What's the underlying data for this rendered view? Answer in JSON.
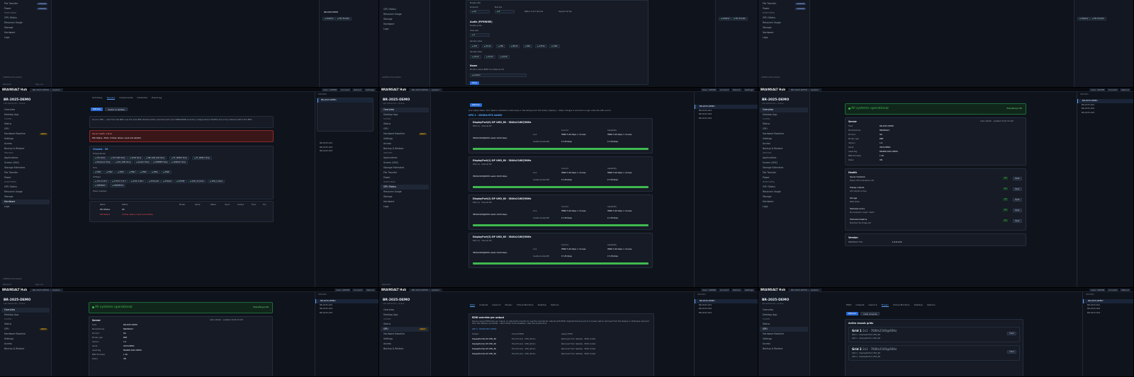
{
  "app": {
    "name": "BRAINSALT Hub",
    "host": "BR-2025-DEMO",
    "host_sub": "192.168.42.20 • Online",
    "footer": "ADMIN Administrator",
    "signout": "Sign out",
    "tab": "BR-2025-DEMO — System"
  },
  "toolbar": {
    "user": "User: ADMIN",
    "connect": "Connect",
    "reboot": "Reboot",
    "settings": "Settings"
  },
  "sidebar": {
    "top": [
      "Overview",
      "Desktop App"
    ],
    "section1": "SYSTEM",
    "items1": [
      "Status",
      "GPU",
      "Hardware Baseline",
      "Settings",
      "Access",
      "Backup & Restore"
    ],
    "section2": "SERVICES",
    "items2": [
      "Applications",
      "Screen (VNC)",
      "Storage Estimates",
      "File Transfer",
      "Power"
    ],
    "section3": "MONITORING",
    "items3": [
      "GPU Status",
      "Resource Usage",
      "Storage",
      "Hardware",
      "Logs"
    ],
    "badge_new": "UPGRADE",
    "badge_warn": "DRAFT"
  },
  "hostlist": {
    "title": "SERVERS",
    "items": [
      "BR-2025-DEMO",
      "BR-2025-001",
      "BR-2025-002",
      "BR-2025-003"
    ]
  },
  "status": {
    "tabs": [
      "Summary",
      "Sensors",
      "Components",
      "Controller",
      "Event log"
    ],
    "refresh": "Refresh",
    "switch": "Switch to Redfish",
    "source_note": "Source: IPMI — read from the BMC over the local IPMI interface (KCS), plus the host's own SMBIOS/MIB inventory. Independent of Redfish and of any network path to the BMC.",
    "critical_title": "Server health: critical",
    "critical_line": "PSU Status · PSU1: Critical, failure, input lost (AC/DC)",
    "chassis": "Chassis · 90",
    "temps_label": "Temperatures",
    "temps": [
      "CPU Temp",
      "CPU VRM Temp",
      "GPU0 Temp",
      "MB_VRM_SAN Temp",
      "PT_DIMM0 Temp",
      "PT_DIMM1 Temp",
      "Peripheral Temp",
      "SOC_VRM Temp",
      "System Temp",
      "VRMMEM Temp",
      "VRMSOC Temp"
    ],
    "fans_label": "Fans",
    "fans": [
      "FAN1",
      "FAN2",
      "FAN3",
      "FAN4",
      "FAN5",
      "FANA",
      "FANB"
    ],
    "volt_label": "Voltages",
    "volts": [
      "12V  12.05 V",
      "3.3VCC  3.31 V",
      "5VCC  4.98 V",
      "5VCCAUX",
      "5VDUAL",
      "5VSTBY",
      "VDD_33_DUAL",
      "VDD_5_DUAL",
      "VMEMSOC",
      "VMEMPSOC"
    ],
    "psu_label": "Power supplies",
    "psu_headers": [
      "Name",
      "Status",
      "Model",
      "Serial",
      "Rated",
      "Input",
      "Output",
      "Fans",
      "Fan"
    ],
    "psu_rows": [
      [
        "PS1 Status",
        "OK"
      ],
      [
        "PS2 Status",
        "Critical, failure, input lost (AC/DC)"
      ]
    ]
  },
  "gpu": {
    "refresh": "Refresh",
    "note": "Live output status. Port detail is refreshed continuously in the background; the history (display + rates) changes is recorded in Logs under the GPU source.",
    "gpu_title": "GPU 1 · NVIDIA RTX A4000",
    "ports": [
      {
        "name": "DisplayPort(0) DP UHD_60 · 3840x2160@60Hz",
        "sub": "DP(1.4) · internal DP"
      },
      {
        "name": "DisplayPort(1) DP UHD_60 · 3840x2160@60Hz",
        "sub": "DP(1.4) · internal DP"
      },
      {
        "name": "DisplayPort(2) DP UHD_60 · 3840x2160@60Hz",
        "sub": "DP(1.4) · internal DP"
      },
      {
        "name": "DisplayPort(3) DP UHD_60 · 3840x2160@60Hz",
        "sub": "DP(1.4) · internal DP"
      }
    ],
    "cols": [
      "Current",
      "Capability"
    ],
    "link_label": "Link",
    "link_cur": "HBR2 5.40 Gbps × 4 lanes",
    "link_cap": "HBR2 5.40 Gbps × 4 lanes",
    "bw_label": "Usable bandwidth",
    "bw_cur": "17.28 Gbps",
    "bw_cap": "17.28 Gbps",
    "needs": "3840x2160@60Hz needs 16.00 Gbps",
    "bw_fraction": 1.0
  },
  "overview": {
    "banner": "All systems operational",
    "banner_right": "Everything is OK",
    "server_title": "Server",
    "auto_refresh": "Auto-refresh · updated 12:01:52 AM",
    "server_kv": [
      [
        "Host",
        "BR-2025-DEMO"
      ],
      [
        "Manufacturer",
        "BRAINSALT"
      ],
      [
        "Product",
        "RG"
      ],
      [
        "Model / gen",
        "BRP"
      ],
      [
        "Version",
        "1.0"
      ],
      [
        "Serial",
        "2025-DEMO"
      ],
      [
        "Asset tag",
        "BR-BRP-2025-DEMO"
      ],
      [
        "BMC firmware",
        "1.36"
      ],
      [
        "Power",
        "ON"
      ]
    ],
    "health_title": "Health",
    "health": [
      [
        "Server hardware",
        "Power, PSU indications OK"
      ],
      [
        "Display outputs",
        "4/4 outputs active"
      ],
      [
        "Storage",
        "RAID state"
      ],
      [
        "Hardware errors",
        "No hardware 'repair' alerts"
      ],
      [
        "Hardware baseline",
        "Matches the image set"
      ]
    ],
    "ok": "OK",
    "open": "Open",
    "version_title": "Version",
    "version_k": "BRAINSALT Hub",
    "version_v": "1.0.0-1.19"
  },
  "edid": {
    "tabs": [
      "EDID",
      "Outputs",
      "Genlock",
      "Mosaic",
      "Virtual Monitors",
      "Desktop",
      "Options"
    ],
    "title": "EDID override per output",
    "desc": "Serve a saved EDID blob per output, so (about the monitor) to use the override for outputs with EDID. Outputs that are part of a mosaic will be removed from the display or otherwise removed from the desktop are hidden - return them to the desktop / clear the mosaic first.",
    "gpu": "GPU 1 · NVIDIA RTX A4000",
    "headers": [
      "Output",
      "Current EDID",
      "Assign EDID"
    ],
    "rows": [
      [
        "DisplayPort(0) DP UHD_60",
        "File (Forced) · UHD_60.bin",
        "Removed from desktop · EDID locked"
      ],
      [
        "DisplayPort(1) DP UHD_60",
        "File (Forced) · UHD_60.bin",
        "Removed from desktop · EDID locked"
      ],
      [
        "DisplayPort(2) DP UHD_60",
        "File (Forced) · UHD_60.bin",
        "Removed from desktop · EDID locked"
      ],
      [
        "DisplayPort(3) DP UHD_60",
        "File (Forced) · UHD_60.bin",
        "Removed from desktop · EDID locked"
      ]
    ]
  },
  "mosaic": {
    "tabs": [
      "EDID",
      "Outputs",
      "Genlock",
      "Mosaic",
      "Virtual Monitors",
      "Desktop",
      "Options"
    ],
    "refresh": "Refresh",
    "clear": "Clear all grids",
    "title": "Active mosaic grids",
    "grids": [
      {
        "name": "Grid 1",
        "spec": "2x1 · 7680x2160@60Hz",
        "l1": "GPU 1 · DisplayPort(0) UHD_60",
        "l2": "GPU 1 · DisplayPort(1) UHD_60"
      },
      {
        "name": "Grid 2",
        "spec": "2x1 · 7680x2160@60Hz",
        "l1": "GPU 1 · DisplayPort(2) UHD_60",
        "l2": "GPU 1 · DisplayPort(3) UHD_60"
      }
    ],
    "clear_btn": "Clear"
  },
  "audio": {
    "enable_osc": "Enable OSC",
    "endpoint": "Endpoint",
    "max_fps": "Max fps",
    "ep_val": "10",
    "fps_val": "8",
    "cb1": "Native 4:2:0 decode",
    "cb2": "Support all fps",
    "audio_title": "Audio (PIPEWIRE)",
    "enable_audio": "Enable audio",
    "channels": "Channels",
    "ch_val": "2",
    "sample_rates": "Sample rates",
    "rates": [
      "32k",
      "44.1k",
      "48k",
      "88.2k",
      "96k",
      "176.4k",
      "192k"
    ],
    "sample_sizes": "Sample sizes",
    "sizes": [
      "16 bit",
      "20 bit",
      "24 bit"
    ],
    "name": "Name",
    "monitor_note": "Monitor name (EDID truncates at 13)",
    "name_val": "Custom"
  },
  "ops": {
    "items": [
      "Desktop",
      "Data",
      "File Transfer",
      "Power"
    ],
    "monitoring": "MONITORING"
  },
  "colors": {
    "accent": "#2a6bd6",
    "ok": "#3fb950",
    "critical": "#f85149",
    "warn": "#e3b341"
  }
}
